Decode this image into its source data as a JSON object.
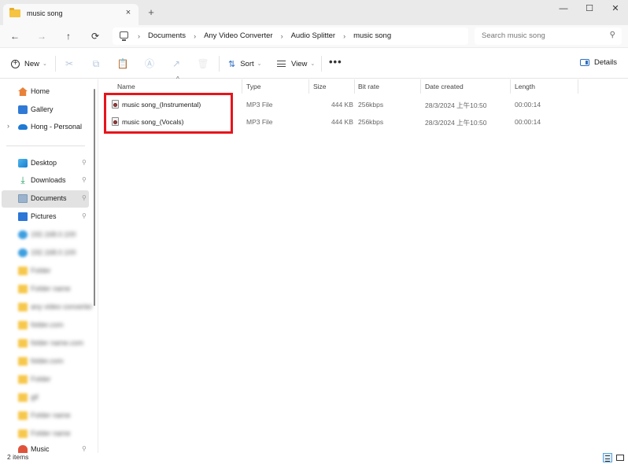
{
  "window": {
    "tab_title": "music song",
    "tab_close_icon": "×",
    "new_tab_icon": "+",
    "minimize_icon": "—",
    "maximize_icon": "☐",
    "close_icon": "✕"
  },
  "nav": {
    "back_icon": "←",
    "forward_icon": "→",
    "up_icon": "↑",
    "refresh_icon": "⟳",
    "breadcrumb": [
      "Documents",
      "Any Video Converter",
      "Audio Splitter",
      "music song"
    ],
    "breadcrumb_sep": "›",
    "search_placeholder": "Search music song",
    "search_icon": "⚲"
  },
  "toolbar": {
    "new_label": "New",
    "sort_label": "Sort",
    "view_label": "View",
    "more_label": "•••",
    "details_label": "Details",
    "chevron": "⌄",
    "cut_icon": "✂",
    "copy_icon": "⧉",
    "paste_icon": "📋",
    "rename_icon": "Ⓐ",
    "share_icon": "↗",
    "delete_icon": "🗑"
  },
  "sidebar": {
    "pin_icon": "📌",
    "expand_icon": "›",
    "top_items": [
      {
        "label": "Home",
        "icon": "home-icon"
      },
      {
        "label": "Gallery",
        "icon": "gallery-icon"
      },
      {
        "label": "Hong - Personal",
        "icon": "cloud-icon"
      }
    ],
    "quick_access": [
      {
        "label": "Desktop",
        "icon": "desktop-icon"
      },
      {
        "label": "Downloads",
        "icon": "download-icon"
      },
      {
        "label": "Documents",
        "icon": "documents-icon",
        "selected": true
      },
      {
        "label": "Pictures",
        "icon": "pictures-icon"
      }
    ],
    "blurred_items": [
      {
        "label": "192.168.0.100"
      },
      {
        "label": "192.168.0.100"
      },
      {
        "label": "Folder"
      },
      {
        "label": "Folder name"
      },
      {
        "label": "any video converter"
      },
      {
        "label": "folder.com"
      },
      {
        "label": "folder name.com"
      },
      {
        "label": "folder.com"
      },
      {
        "label": "Folder"
      },
      {
        "label": "gif"
      },
      {
        "label": "Folder name"
      },
      {
        "label": "Folder name"
      }
    ],
    "music_label": "Music"
  },
  "columns": {
    "name": "Name",
    "type": "Type",
    "size": "Size",
    "bitrate": "Bit rate",
    "date": "Date created",
    "length": "Length",
    "sort_caret": "^"
  },
  "files": [
    {
      "name": "music song_(Instrumental)",
      "type": "MP3 File",
      "size": "444 KB",
      "bitrate": "256kbps",
      "date": "28/3/2024 上午10:50",
      "length": "00:00:14"
    },
    {
      "name": "music song_(Vocals)",
      "type": "MP3 File",
      "size": "444 KB",
      "bitrate": "256kbps",
      "date": "28/3/2024 上午10:50",
      "length": "00:00:14"
    }
  ],
  "status": {
    "item_count": "2 items"
  }
}
